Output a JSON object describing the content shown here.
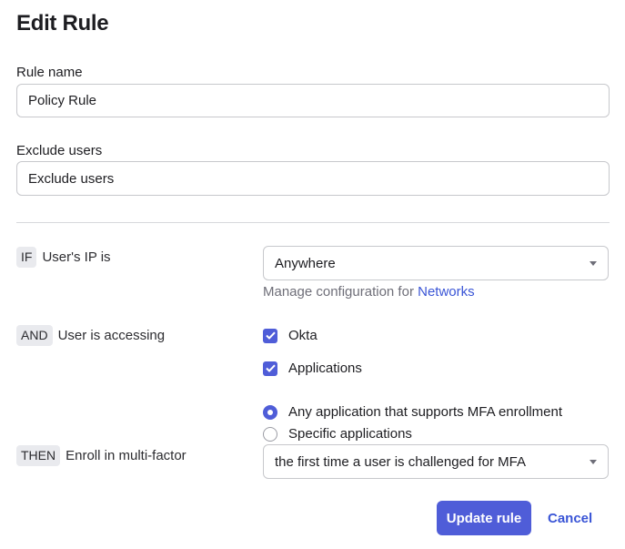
{
  "page": {
    "title": "Edit Rule"
  },
  "form": {
    "rule_name": {
      "label": "Rule name",
      "value": "Policy Rule"
    },
    "exclude_users": {
      "label": "Exclude users",
      "placeholder": "Exclude users"
    }
  },
  "conditions": {
    "if": {
      "keyword": "IF",
      "text": "User's IP is",
      "selected": "Anywhere",
      "help_prefix": "Manage configuration for",
      "help_link": "Networks"
    },
    "and": {
      "keyword": "AND",
      "text": "User is accessing",
      "checkboxes": [
        {
          "label": "Okta",
          "checked": true
        },
        {
          "label": "Applications",
          "checked": true
        }
      ],
      "radios": [
        {
          "label": "Any application that supports MFA enrollment",
          "selected": true
        },
        {
          "label": "Specific applications",
          "selected": false
        }
      ]
    },
    "then": {
      "keyword": "THEN",
      "text": "Enroll in multi-factor",
      "selected": "the first time a user is challenged for MFA"
    }
  },
  "actions": {
    "update_label": "Update rule",
    "cancel_label": "Cancel"
  },
  "colors": {
    "accent": "#4f5dd8",
    "link": "#3a55d6"
  }
}
